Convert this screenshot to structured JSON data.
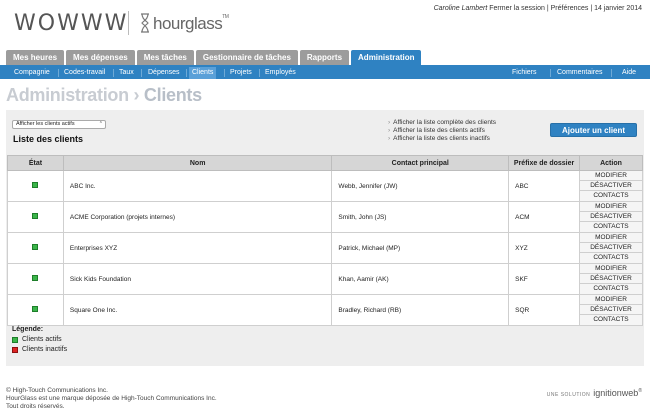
{
  "header": {
    "logo_main": "WOWWW",
    "logo_secondary": "hourglass",
    "logo_tm": "TM",
    "user_name": "Caroline Lambert",
    "logout": "Fermer la session",
    "prefs": "Préférences",
    "date": "14 janvier 2014"
  },
  "tabs": [
    {
      "label": "Mes heures",
      "active": false
    },
    {
      "label": "Mes dépenses",
      "active": false
    },
    {
      "label": "Mes tâches",
      "active": false
    },
    {
      "label": "Gestionnaire de tâches",
      "active": false
    },
    {
      "label": "Rapports",
      "active": false
    },
    {
      "label": "Administration",
      "active": true
    }
  ],
  "subnav": {
    "left": [
      "Compagnie",
      "Codes-travail",
      "Taux",
      "Dépenses",
      "Clients",
      "Projets",
      "Employés"
    ],
    "active": "Clients",
    "right": [
      "Fichiers",
      "Commentaires",
      "Aide"
    ]
  },
  "page": {
    "crumb": "Administration",
    "separator": "›",
    "title": "Clients"
  },
  "filter": {
    "selected": "Afficher les clients actifs",
    "caret": "⌃"
  },
  "list_title": "Liste des clients",
  "links": [
    "Afficher la liste complète des clients",
    "Afficher la liste des clients actifs",
    "Afficher la liste des clients inactifs"
  ],
  "add_button": "Ajouter un client",
  "table": {
    "headers": [
      "État",
      "Nom",
      "Contact principal",
      "Préfixe de dossier",
      "Action"
    ],
    "actions": [
      "MODIFIER",
      "DÉSACTIVER",
      "CONTACTS"
    ],
    "rows": [
      {
        "name": "ABC Inc.",
        "contact": "Webb, Jennifer (JW)",
        "prefix": "ABC"
      },
      {
        "name": "ACME Corporation (projets internes)",
        "contact": "Smith, John (JS)",
        "prefix": "ACM"
      },
      {
        "name": "Enterprises XYZ",
        "contact": "Patrick, Michael (MP)",
        "prefix": "XYZ"
      },
      {
        "name": "Sick Kids Foundation",
        "contact": "Khan, Aamir (AK)",
        "prefix": "SKF"
      },
      {
        "name": "Square One Inc.",
        "contact": "Bradley, Richard (RB)",
        "prefix": "SQR"
      }
    ]
  },
  "legend": {
    "title": "Légende:",
    "active": "Clients actifs",
    "inactive": "Clients inactifs"
  },
  "footer": {
    "line1": "© High-Touch Communications Inc.",
    "line2": "HourGlass est une marque déposée de High-Touch Communications Inc.",
    "line3": "Tout droits réservés."
  },
  "brand": {
    "prefix": "UNE SOLUTION",
    "name": "ignitionweb",
    "tm": "®"
  },
  "colors": {
    "accent": "#2f82c2",
    "active_status": "#3bb54a",
    "inactive_status": "#dd2222"
  }
}
